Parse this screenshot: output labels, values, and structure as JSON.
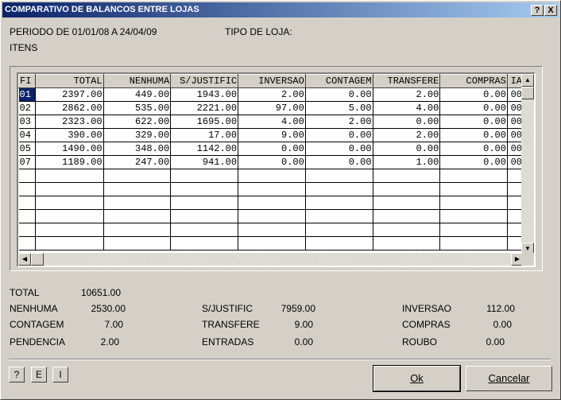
{
  "window": {
    "title": "COMPARATIVO DE BALANCOS ENTRE LOJAS",
    "help_btn": "?",
    "close_btn": "X"
  },
  "header": {
    "periodo": "PERIODO DE 01/01/08 A 24/04/09",
    "tipo_loja": "TIPO DE LOJA:",
    "itens": "ITENS"
  },
  "grid": {
    "columns": [
      "FI",
      "TOTAL",
      "NENHUMA",
      "S/JUSTIFIC",
      "INVERSAO",
      "CONTAGEM",
      "TRANSFERE",
      "COMPRAS",
      "IA"
    ],
    "rows": [
      [
        "01",
        "2397.00",
        "449.00",
        "1943.00",
        "2.00",
        "0.00",
        "2.00",
        "0.00",
        "00"
      ],
      [
        "02",
        "2862.00",
        "535.00",
        "2221.00",
        "97.00",
        "5.00",
        "4.00",
        "0.00",
        "00"
      ],
      [
        "03",
        "2323.00",
        "622.00",
        "1695.00",
        "4.00",
        "2.00",
        "0.00",
        "0.00",
        "00"
      ],
      [
        "04",
        "390.00",
        "329.00",
        "17.00",
        "9.00",
        "0.00",
        "2.00",
        "0.00",
        "00"
      ],
      [
        "05",
        "1490.00",
        "348.00",
        "1142.00",
        "0.00",
        "0.00",
        "0.00",
        "0.00",
        "00"
      ],
      [
        "07",
        "1189.00",
        "247.00",
        "941.00",
        "0.00",
        "0.00",
        "1.00",
        "0.00",
        "00"
      ]
    ]
  },
  "totals": {
    "total_label": "TOTAL",
    "total_value": "10651.00",
    "nenhuma_label": "NENHUMA",
    "nenhuma_value": "2530.00",
    "contagem_label": "CONTAGEM",
    "contagem_value": "7.00",
    "pendencia_label": "PENDENCIA",
    "pendencia_value": "2.00",
    "sjustific_label": "S/JUSTIFIC",
    "sjustific_value": "7959.00",
    "transfere_label": "TRANSFERE",
    "transfere_value": "9.00",
    "entradas_label": "ENTRADAS",
    "entradas_value": "0.00",
    "inversao_label": "INVERSAO",
    "inversao_value": "112.00",
    "compras_label": "COMPRAS",
    "compras_value": "0.00",
    "roubo_label": "ROUBO",
    "roubo_value": "0.00"
  },
  "buttons": {
    "help": "?",
    "e": "E",
    "i": "I",
    "ok": "Ok",
    "cancel": "Cancelar"
  },
  "colors": {
    "titlebar": "#0a246a",
    "selected_cell": "#0a246a",
    "face": "#d4d0c8"
  }
}
